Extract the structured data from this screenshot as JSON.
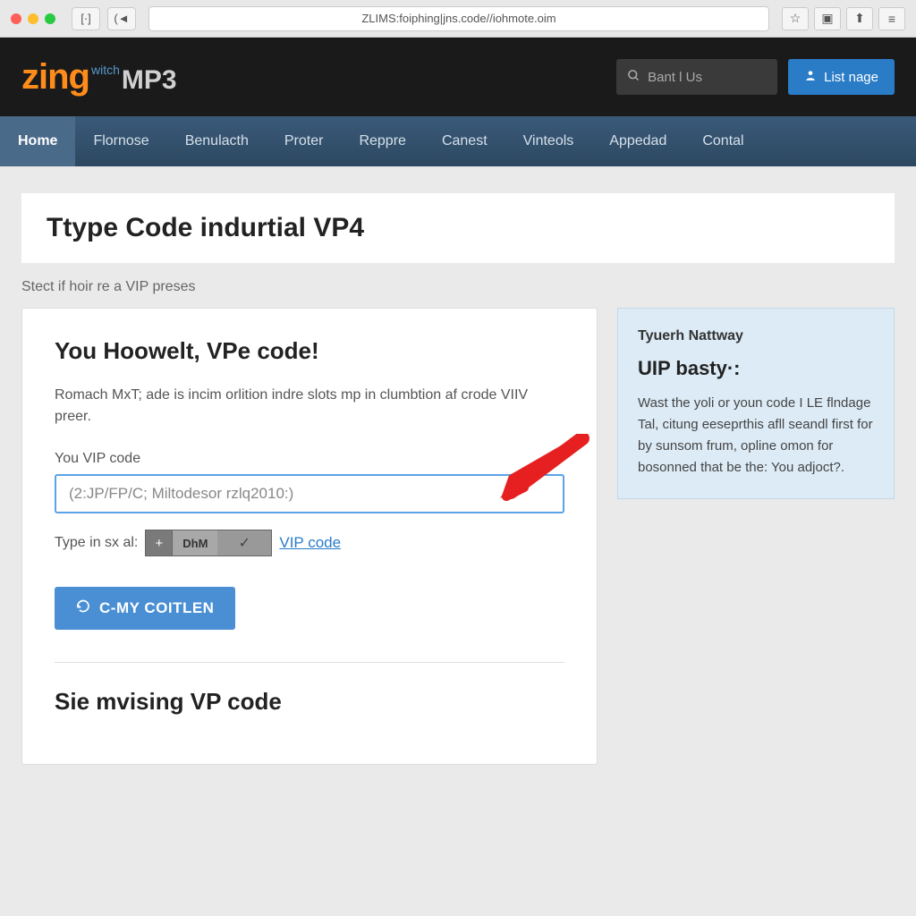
{
  "browser": {
    "url": "ZLIMS:foiphing|jns.code//iohmote.oim",
    "back_icon": "[·]",
    "forward_icon": "(◄",
    "star_icon": "☆",
    "reader_icon": "▣",
    "share_icon": "⬆",
    "menu_icon": "≡"
  },
  "header": {
    "logo_zing": "zing",
    "logo_witch": "witch",
    "logo_mp3": "MP3",
    "search_placeholder": "Bant l Us",
    "login_label": "List nage"
  },
  "nav": {
    "items": [
      {
        "label": "Home",
        "active": true
      },
      {
        "label": "Flornose",
        "active": false
      },
      {
        "label": "Benulacth",
        "active": false
      },
      {
        "label": "Proter",
        "active": false
      },
      {
        "label": "Reppre",
        "active": false
      },
      {
        "label": "Canest",
        "active": false
      },
      {
        "label": "Vinteols",
        "active": false
      },
      {
        "label": "Appedad",
        "active": false
      },
      {
        "label": "Contal",
        "active": false
      }
    ]
  },
  "page": {
    "title": "Ttype Code indurtial VP4",
    "subtitle": "Stect if hoir re a VIP preses"
  },
  "card": {
    "heading": "You Hoowelt, VPe code!",
    "description": "Romach MxT; ade is incim orlition indre slots mp in clumbtion af crode VIIV preer.",
    "field_label": "You VIP code",
    "input_value": "(2:JP/FP/C; Miltodesor rzlq2010:)",
    "type_label": "Type in sx al:",
    "stepper_plus": "+",
    "stepper_value": "DhM",
    "stepper_check": "✓",
    "vip_link": "VIP code",
    "submit_label": "C-MY COITLEN",
    "section2_title": "Sie mvising VP code"
  },
  "sidebar": {
    "label": "Tyuerh Nattway",
    "title": "UIP basty·:",
    "text": "Wast the yoli or youn code I LE flndage Tal, citung eeseprthis afll seandl first for by sunsom frum, opline omon for bosonned that be the: You adjoct?."
  },
  "colors": {
    "accent_orange": "#ff8c1a",
    "accent_blue": "#2a7cc7",
    "nav_bg": "#3a5a7a"
  }
}
